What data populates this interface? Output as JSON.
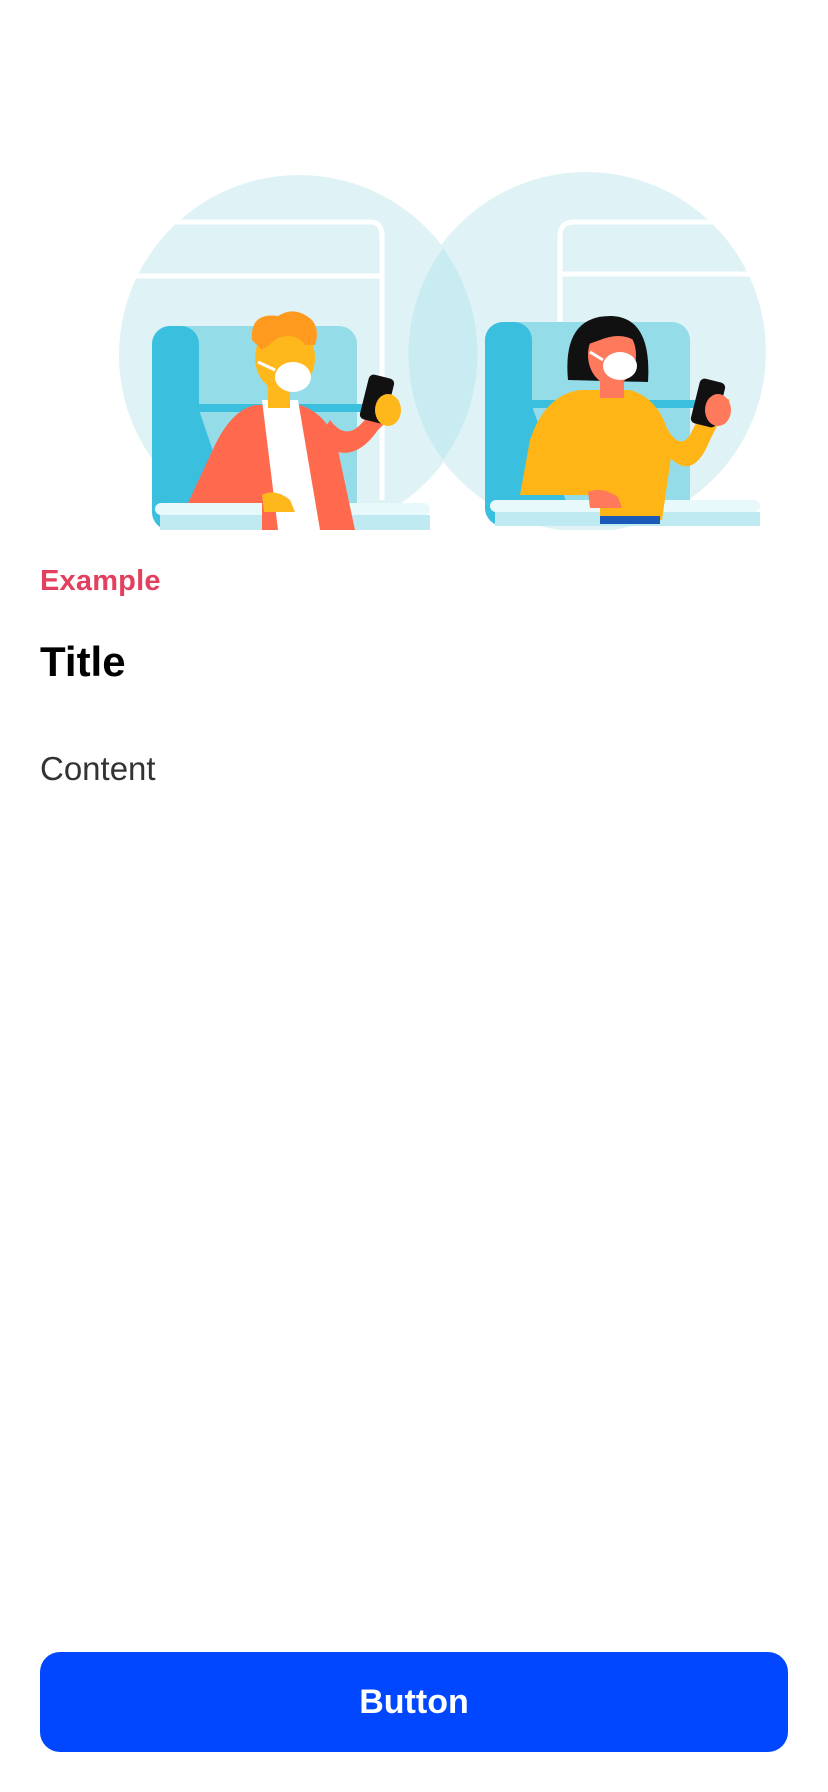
{
  "card": {
    "eyebrow": "Example",
    "title": "Title",
    "content": "Content",
    "button_label": "Button"
  },
  "illustration": {
    "subject": "two-masked-passengers-using-phones-on-train"
  },
  "colors": {
    "eyebrow": "#e2405e",
    "button_bg": "#0047ff",
    "button_text": "#ffffff",
    "title": "#000000",
    "content": "#333333",
    "circle": "#dff3f6",
    "seat": "#3bbfdf",
    "seat_light": "#95dce9",
    "man_jacket": "#ff6a4f",
    "skin": "#ffb81c",
    "woman_sweater": "#ffb515"
  }
}
